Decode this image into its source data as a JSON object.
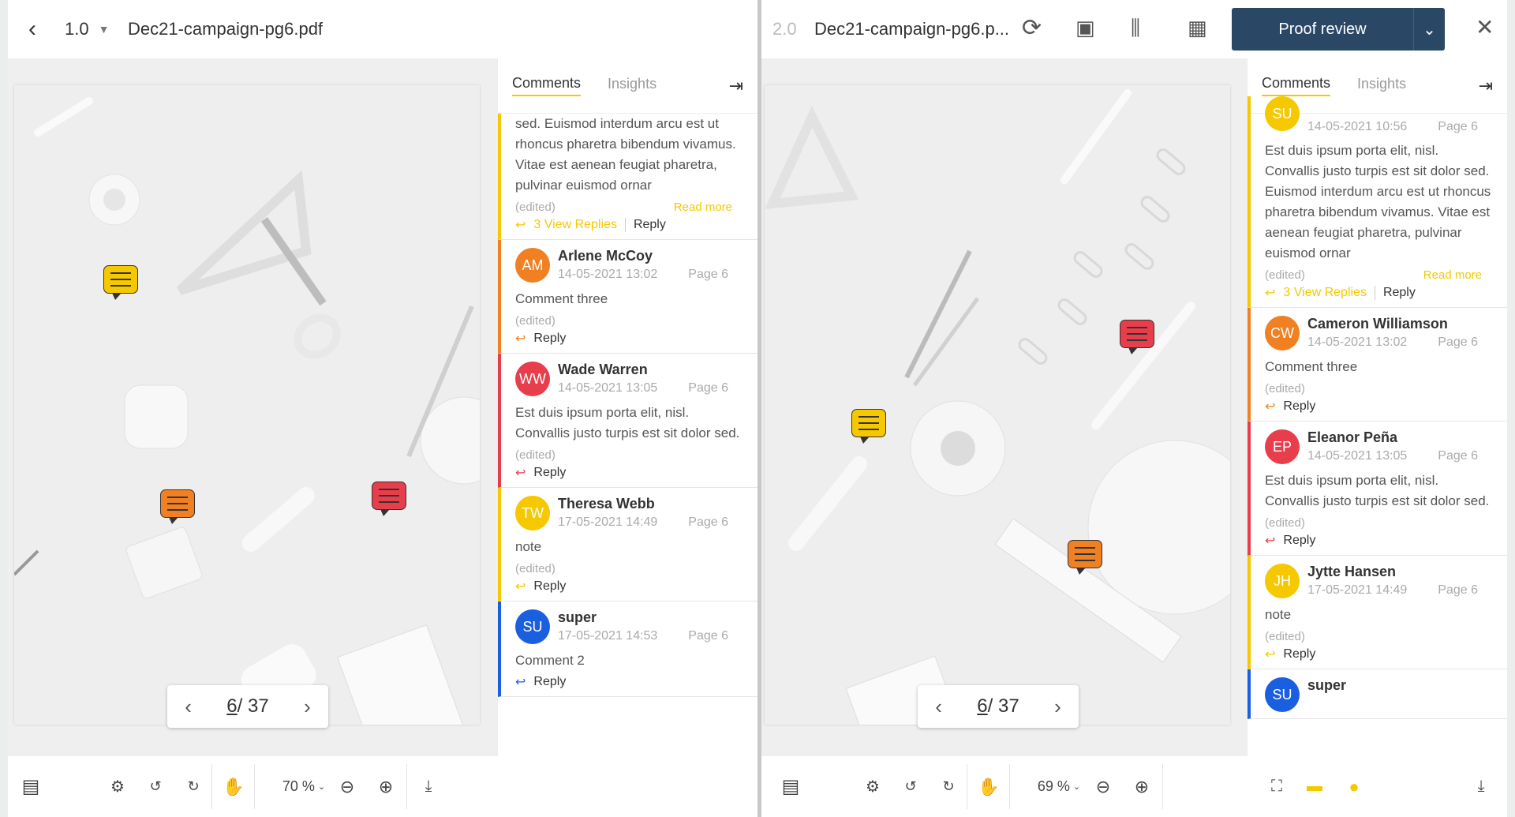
{
  "left": {
    "version": "1.0",
    "filename": "Dec21-campaign-pg6.pdf",
    "tabs": [
      "Comments",
      "Insights"
    ],
    "page_current": "6",
    "page_total": "/ 37",
    "zoom": "70 %",
    "comments": [
      {
        "partial": true,
        "color": "#f5c800",
        "body": "sed. Euismod interdum arcu est ut rhoncus pharetra bibendum vivamus. Vitae est aenean feugiat pharetra, pulvinar euismod ornar",
        "edited": "(edited)",
        "readmore": "Read more",
        "replies": "3  View Replies",
        "reply": "Reply"
      },
      {
        "initials": "AM",
        "name": "Arlene McCoy",
        "date": "14-05-2021 13:02",
        "page": "Page 6",
        "color": "#f08021",
        "body": "Comment three",
        "edited": "(edited)",
        "reply": "Reply"
      },
      {
        "initials": "WW",
        "name": "Wade Warren",
        "date": "14-05-2021 13:05",
        "page": "Page 6",
        "color": "#e83e4c",
        "body": "Est duis ipsum porta elit, nisl. Convallis justo turpis est sit dolor sed.",
        "edited": "(edited)",
        "reply": "Reply"
      },
      {
        "initials": "TW",
        "name": "Theresa Webb",
        "date": "17-05-2021 14:49",
        "page": "Page 6",
        "color": "#f5c800",
        "body": "note",
        "edited": "(edited)",
        "reply": "Reply"
      },
      {
        "initials": "SU",
        "name": "super",
        "date": "17-05-2021 14:53",
        "page": "Page 6",
        "color": "#1a5fe0",
        "body": "Comment 2",
        "reply": "Reply"
      }
    ]
  },
  "right": {
    "version": "2.0",
    "filename": "Dec21-campaign-pg6.p...",
    "proof_label": "Proof review",
    "tabs": [
      "Comments",
      "Insights"
    ],
    "page_current": "6",
    "page_total": "/ 37",
    "zoom": "69 %",
    "comments": [
      {
        "partial": true,
        "initials": "SU",
        "date": "14-05-2021 10:56",
        "page": "Page 6",
        "color": "#f5c800",
        "body": "Est duis ipsum porta elit, nisl. Convallis justo turpis est sit dolor sed. Euismod interdum arcu est ut rhoncus pharetra bibendum vivamus. Vitae est aenean feugiat pharetra, pulvinar euismod ornar",
        "edited": "(edited)",
        "readmore": "Read more",
        "replies": "3  View Replies",
        "reply": "Reply"
      },
      {
        "initials": "CW",
        "name": "Cameron Williamson",
        "date": "14-05-2021 13:02",
        "page": "Page 6",
        "color": "#f08021",
        "body": "Comment three",
        "edited": "(edited)",
        "reply": "Reply"
      },
      {
        "initials": "EP",
        "name": "Eleanor Peña",
        "date": "14-05-2021 13:05",
        "page": "Page 6",
        "color": "#e83e4c",
        "body": "Est duis ipsum porta elit, nisl. Convallis justo turpis est sit dolor sed.",
        "edited": "(edited)",
        "reply": "Reply"
      },
      {
        "initials": "JH",
        "name": "Jytte Hansen",
        "date": "17-05-2021 14:49",
        "page": "Page 6",
        "color": "#f5c800",
        "body": "note",
        "edited": "(edited)",
        "reply": "Reply"
      },
      {
        "initials": "SU",
        "name": "super",
        "color": "#1a5fe0"
      }
    ]
  }
}
